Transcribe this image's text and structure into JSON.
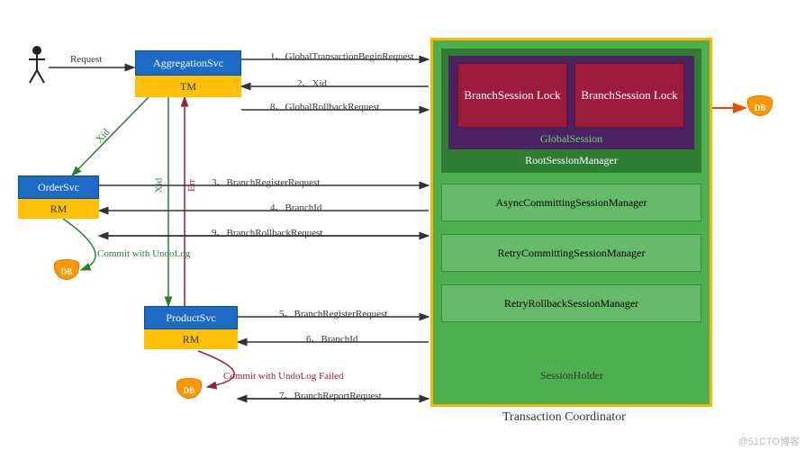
{
  "actor": {
    "request_label": "Request"
  },
  "aggregation": {
    "name": "AggregationSvc",
    "role": "TM"
  },
  "order": {
    "name": "OrderSvc",
    "role": "RM",
    "commit_label": "Commit with UndoLog"
  },
  "product": {
    "name": "ProductSvc",
    "role": "RM",
    "commit_label": "Commit with UndoLog Failed"
  },
  "db_label": "DB",
  "xid_label": "Xid",
  "err_label": "Err",
  "coordinator": {
    "title": "Transaction Coordinator",
    "root": "RootSessionManager",
    "async": "AsyncCommittingSessionManager",
    "retry_commit": "RetryCommittingSessionManager",
    "retry_rollback": "RetryRollbackSessionManager",
    "holder": "SessionHolder",
    "global_session": "GlobalSession",
    "branch_lock_1": "BranchSession Lock",
    "branch_lock_2": "BranchSession Lock"
  },
  "messages": {
    "m1": "1、GlobalTransactionBeginRequest",
    "m2": "2、Xid",
    "m3": "3、BranchRegisterRequest",
    "m4": "4、BranchId",
    "m5": "5、BranchRegisterRequest",
    "m6": "6、BranchId",
    "m7": "7、BranchReportRequest",
    "m8": "8、GlobalRollbackRequest",
    "m9": "9、BranchRollbackRequest"
  },
  "watermark": "@51CTO博客"
}
